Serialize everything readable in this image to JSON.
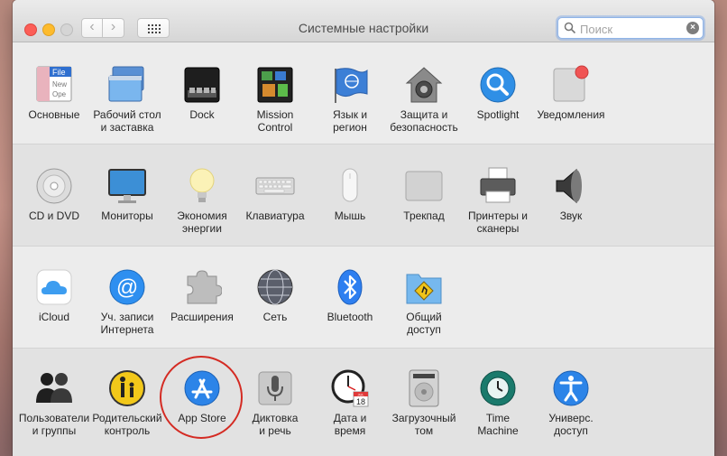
{
  "window": {
    "title": "Системные настройки",
    "search_placeholder": "Поиск",
    "nav_back": "‹",
    "nav_forward": "›",
    "clear_glyph": "×"
  },
  "sections": [
    {
      "items": [
        {
          "id": "general",
          "label": "Основные",
          "icon": "general-icon",
          "file_lines": [
            "File",
            "New",
            "Ope"
          ]
        },
        {
          "id": "desktop",
          "label": "Рабочий стол\nи заставка",
          "icon": "desktop-screensaver-icon"
        },
        {
          "id": "dock",
          "label": "Dock",
          "icon": "dock-icon"
        },
        {
          "id": "mission",
          "label": "Mission\nControl",
          "icon": "mission-control-icon"
        },
        {
          "id": "language",
          "label": "Язык и\nрегион",
          "icon": "language-region-icon"
        },
        {
          "id": "security",
          "label": "Защита и\nбезопасность",
          "icon": "security-privacy-icon"
        },
        {
          "id": "spotlight",
          "label": "Spotlight",
          "icon": "spotlight-icon"
        },
        {
          "id": "notifications",
          "label": "Уведомления",
          "icon": "notifications-icon"
        }
      ]
    },
    {
      "items": [
        {
          "id": "cddvd",
          "label": "CD и DVD",
          "icon": "cd-dvd-icon"
        },
        {
          "id": "displays",
          "label": "Мониторы",
          "icon": "displays-icon"
        },
        {
          "id": "energy",
          "label": "Экономия\nэнергии",
          "icon": "energy-saver-icon"
        },
        {
          "id": "keyboard",
          "label": "Клавиатура",
          "icon": "keyboard-icon"
        },
        {
          "id": "mouse",
          "label": "Мышь",
          "icon": "mouse-icon"
        },
        {
          "id": "trackpad",
          "label": "Трекпад",
          "icon": "trackpad-icon"
        },
        {
          "id": "printers",
          "label": "Принтеры и\nсканеры",
          "icon": "printers-scanners-icon"
        },
        {
          "id": "sound",
          "label": "Звук",
          "icon": "sound-icon"
        }
      ]
    },
    {
      "items": [
        {
          "id": "icloud",
          "label": "iCloud",
          "icon": "icloud-icon"
        },
        {
          "id": "accounts",
          "label": "Уч. записи\nИнтернета",
          "icon": "internet-accounts-icon",
          "glyph": "@"
        },
        {
          "id": "extensions",
          "label": "Расширения",
          "icon": "extensions-icon"
        },
        {
          "id": "network",
          "label": "Сеть",
          "icon": "network-icon"
        },
        {
          "id": "bluetooth",
          "label": "Bluetooth",
          "icon": "bluetooth-icon"
        },
        {
          "id": "sharing",
          "label": "Общий\nдоступ",
          "icon": "sharing-icon"
        }
      ]
    },
    {
      "items": [
        {
          "id": "users",
          "label": "Пользователи\nи группы",
          "icon": "users-groups-icon"
        },
        {
          "id": "parental",
          "label": "Родительский\nконтроль",
          "icon": "parental-controls-icon"
        },
        {
          "id": "appstore",
          "label": "App Store",
          "icon": "app-store-icon"
        },
        {
          "id": "dictation",
          "label": "Диктовка\nи речь",
          "icon": "dictation-speech-icon"
        },
        {
          "id": "datetime",
          "label": "Дата и\nвремя",
          "icon": "date-time-icon",
          "cal_month": "JUL",
          "cal_day": "18"
        },
        {
          "id": "startup",
          "label": "Загрузочный\nтом",
          "icon": "startup-disk-icon"
        },
        {
          "id": "timemachine",
          "label": "Time\nMachine",
          "icon": "time-machine-icon"
        },
        {
          "id": "accessibility",
          "label": "Универс.\nдоступ",
          "icon": "accessibility-icon"
        }
      ]
    }
  ]
}
